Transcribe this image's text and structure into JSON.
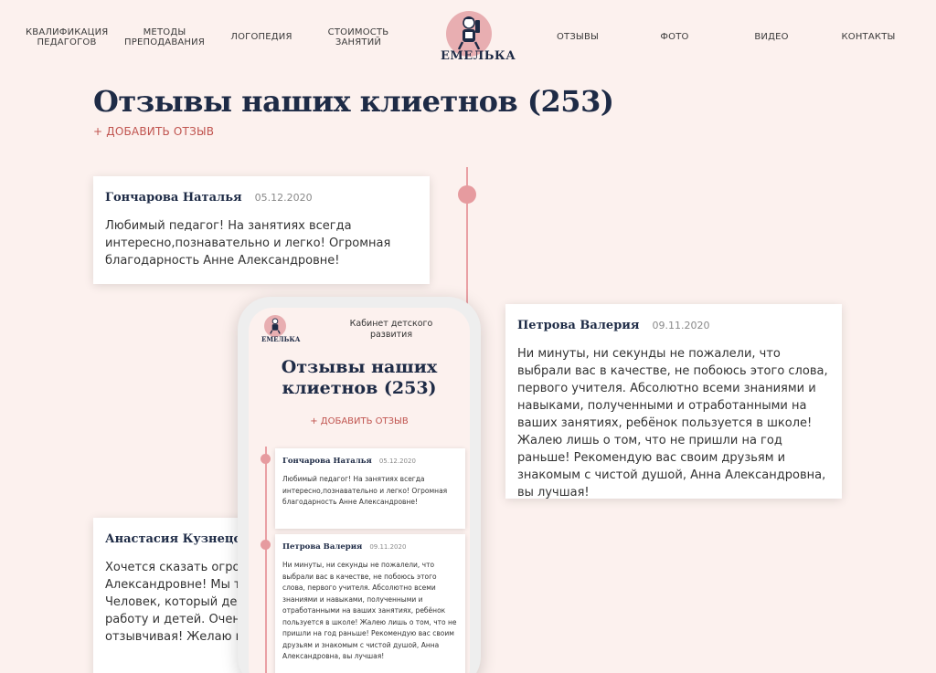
{
  "nav": {
    "left": [
      {
        "line1": "Квалификация",
        "line2": "педагогов"
      },
      {
        "line1": "Методы",
        "line2": "преподавания"
      },
      {
        "line1": "Логопедия",
        "line2": ""
      },
      {
        "line1": "Стоимость",
        "line2": "занятий"
      }
    ],
    "right": [
      "Отзывы",
      "Фото",
      "Видео",
      "Контакты"
    ],
    "logo_text": "ЕМЕЛЬКА"
  },
  "page": {
    "title": "Отзывы наших клиетнов (253)",
    "add_review": "+ ДОБАВИТЬ ОТЗЫВ"
  },
  "reviews": [
    {
      "author": "Гончарова Наталья",
      "date": "05.12.2020",
      "text": "Любимый педагог! На занятиях всегда интересно,познавательно и легко! Огромная благодарность Анне Александровне!"
    },
    {
      "author": "Петрова Валерия",
      "date": "09.11.2020",
      "text": "Ни минуты, ни секунды не пожалели, что выбрали вас в качестве, не побоюсь этого слова, первого учителя. Абсолютно всеми знаниями и навыками, полученными и отработанными на ваших занятиях, ребёнок пользуется в школе! Жалею лишь о том, что не пришли на год раньше! Рекомендую вас своим друзьям и знакомым с чистой душой, Анна Александровна, вы лучшая!"
    },
    {
      "author": "Анастасия Кузнецова",
      "text": "Хочется сказать огромное спасибо Анне Александровне! Мы так рады, что попали к вам! Человек, который действительно любит свою работу и детей. Очень внимательная,чуткая, отзывчивая! Желаю вам всего самого доброго"
    }
  ],
  "mobile": {
    "logo_text": "ЕМЕЛЬКА",
    "subtitle": "Кабинет детского развития",
    "title": "Отзывы наших клиетнов (253)",
    "add_review": "+ ДОБАВИТЬ ОТЗЫВ"
  },
  "colors": {
    "background": "#fcf1ee",
    "accent": "#e69b9f",
    "heading": "#1e2b46",
    "link": "#c0544f"
  }
}
